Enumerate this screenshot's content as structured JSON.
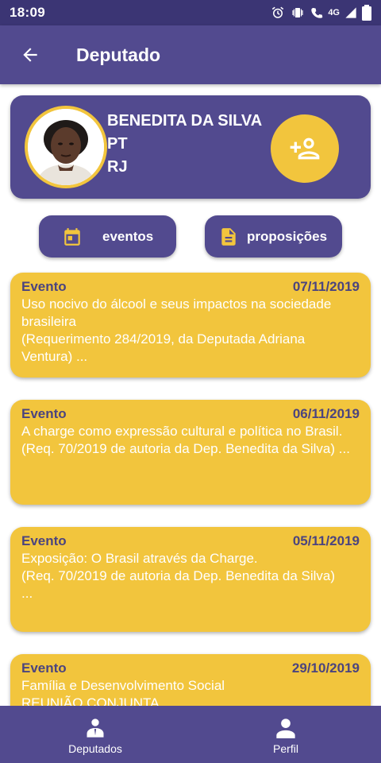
{
  "status": {
    "time": "18:09",
    "network": "4G"
  },
  "app_bar": {
    "title": "Deputado"
  },
  "profile": {
    "name": "BENEDITA DA SILVA",
    "party": "PT",
    "state": "RJ"
  },
  "tabs": {
    "events": "eventos",
    "propositions": "proposições"
  },
  "events": [
    {
      "type": "Evento",
      "date": "07/11/2019",
      "text": "Uso nocivo do álcool e seus impactos na sociedade brasileira\n (Requerimento 284/2019, da Deputada Adriana Ventura) ..."
    },
    {
      "type": "Evento",
      "date": "06/11/2019",
      "text": "A charge como expressão cultural e política no Brasil.\n (Req. 70/2019 de autoria da Dep. Benedita da Silva) ..."
    },
    {
      "type": "Evento",
      "date": "05/11/2019",
      "text": "Exposição: O Brasil através da Charge.\n (Req. 70/2019 de autoria da Dep. Benedita da Silva)\n ..."
    },
    {
      "type": "Evento",
      "date": "29/10/2019",
      "text": "Família e Desenvolvimento Social\n REUNIÃO CONJUNTA"
    }
  ],
  "bottom_nav": {
    "deputies": "Deputados",
    "profile": "Perfil"
  },
  "colors": {
    "primary": "#524a8f",
    "accent": "#f2c53d",
    "status_bar": "#3b3574"
  }
}
